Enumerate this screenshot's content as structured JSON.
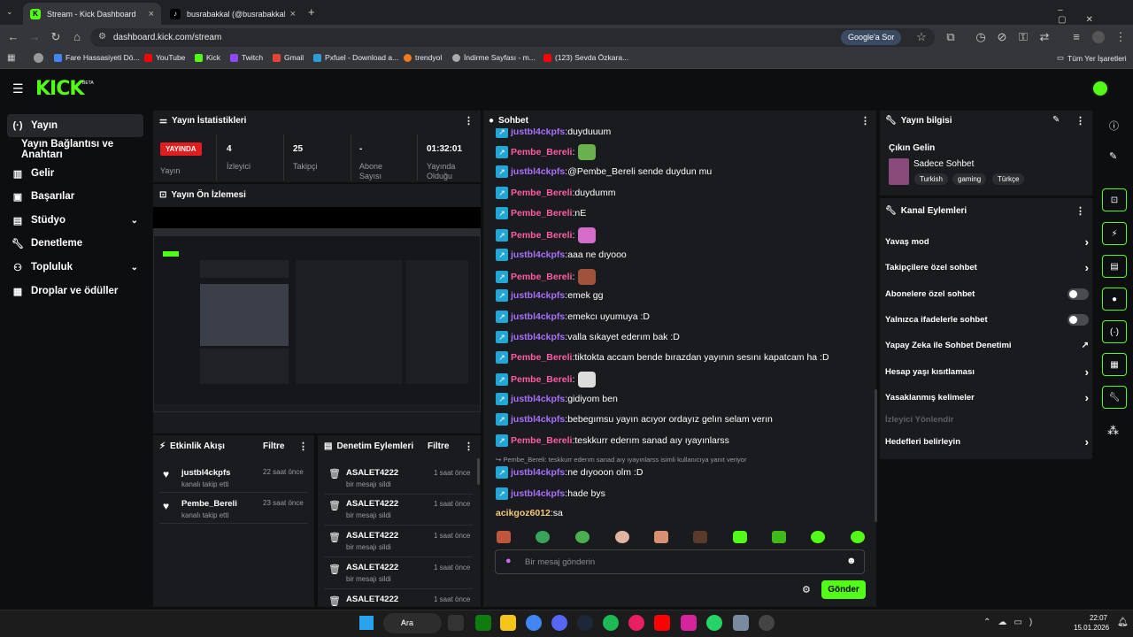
{
  "browser": {
    "tabs": [
      {
        "title": "Stream - Kick Dashboard",
        "favicon": "kick-logo-icon"
      },
      {
        "title": "busrabakkal (@busrabakkal",
        "favicon": "tiktok-icon"
      }
    ],
    "url": "dashboard.kick.com/stream",
    "google_btn": "Google'a Sor",
    "bookmarks": [
      "Fare Hassasiyeti Dö...",
      "YouTube",
      "Kick",
      "Twitch",
      "Gmail",
      "Pxfuel - Download a...",
      "trendyol",
      "İndirme Sayfası - m...",
      "(123) Sevda Özkara...",
      "Tüm Yer İşaretleri"
    ]
  },
  "nav": {
    "items": [
      {
        "label": "Yayın",
        "icon": "broadcast-icon"
      },
      {
        "label": "Yayın Bağlantısı ve Anahtarı",
        "icon": ""
      },
      {
        "label": "Gelir",
        "icon": "chart-icon"
      },
      {
        "label": "Başarılar",
        "icon": "trophy-icon"
      },
      {
        "label": "Stüdyo",
        "icon": "studio-icon"
      },
      {
        "label": "Denetleme",
        "icon": "wrench-icon"
      },
      {
        "label": "Topluluk",
        "icon": "people-icon"
      },
      {
        "label": "Droplar ve ödüller",
        "icon": "gift-icon"
      }
    ]
  },
  "stats": {
    "title": "Yayın İstatistikleri",
    "live": "YAYINDA",
    "status_label": "Yayın",
    "viewers": "4",
    "viewers_label": "İzleyici",
    "followers": "25",
    "followers_label": "Takipçi",
    "subs": "-",
    "subs_label": "Abone Sayısı",
    "duration": "01:32:01",
    "duration_label": "Yayında Olduğu"
  },
  "preview": {
    "title": "Yayın Ön İzlemesi"
  },
  "activity": {
    "title": "Etkinlik Akışı",
    "filter": "Filtre",
    "items": [
      {
        "name": "justbl4ckpfs",
        "sub": "kanalı takip etti",
        "time": "22 saat önce"
      },
      {
        "name": "Pembe_Bereli",
        "sub": "kanalı takip etti",
        "time": "23 saat önce"
      }
    ]
  },
  "mod": {
    "title": "Denetim Eylemleri",
    "filter": "Filtre",
    "items": [
      {
        "name": "ASALET4222",
        "sub": "bir mesajı sildi",
        "time": "1 saat önce"
      },
      {
        "name": "ASALET4222",
        "sub": "bir mesajı sildi",
        "time": "1 saat önce"
      },
      {
        "name": "ASALET4222",
        "sub": "bir mesajı sildi",
        "time": "1 saat önce"
      },
      {
        "name": "ASALET4222",
        "sub": "bir mesajı sildi",
        "time": "1 saat önce"
      },
      {
        "name": "ASALET4222",
        "sub": "",
        "time": "1 saat önce"
      }
    ]
  },
  "chat": {
    "title": "Sohbet",
    "messages": [
      {
        "user": "justbl4ckpfs",
        "text": "duyduuum",
        "emote": ""
      },
      {
        "user": "Pembe_Bereli",
        "text": "",
        "emote": "#6ab04c"
      },
      {
        "user": "justbl4ckpfs",
        "text": "@Pembe_Bereli sende duydun mu",
        "emote": ""
      },
      {
        "user": "Pembe_Bereli",
        "text": "duydumm",
        "emote": ""
      },
      {
        "user": "Pembe_Bereli",
        "text": "nE",
        "emote": ""
      },
      {
        "user": "Pembe_Bereli",
        "text": "",
        "emote": "#d66cc9"
      },
      {
        "user": "justbl4ckpfs",
        "text": "aaa ne dıyooo",
        "emote": ""
      },
      {
        "user": "Pembe_Bereli",
        "text": "",
        "emote": "#a0523d"
      },
      {
        "user": "justbl4ckpfs",
        "text": "emek gg",
        "emote": ""
      },
      {
        "user": "justbl4ckpfs",
        "text": "emekcı uyumuya :D",
        "emote": ""
      },
      {
        "user": "justbl4ckpfs",
        "text": "valla sıkayet ederım bak :D",
        "emote": ""
      },
      {
        "user": "Pembe_Bereli",
        "text": "tiktokta accam bende bırazdan yayının sesını kapatcam ha :D",
        "emote": ""
      },
      {
        "user": "Pembe_Bereli",
        "text": "",
        "emote": "#dddddd"
      },
      {
        "user": "justbl4ckpfs",
        "text": "gidiyom ben",
        "emote": ""
      },
      {
        "user": "justbl4ckpfs",
        "text": "bebegımsu yayın acıyor ordayız gelın selam verın",
        "emote": ""
      },
      {
        "user": "Pembe_Bereli",
        "text": "teskkurr ederım sanad aıy ıyayınlarss",
        "emote": ""
      }
    ],
    "reply_note": "Pembe_Bereli: teskkurr ederım sanad aıy ıyayınlarss isimli kullanıcıya yanıt veriyor",
    "after": [
      {
        "user": "justbl4ckpfs",
        "text": "ne dıyooon olm :D"
      },
      {
        "user": "justbl4ckpfs",
        "text": "hade bys"
      }
    ],
    "self": {
      "user": "acikgoz6012",
      "text": "sa"
    },
    "placeholder": "Bir mesaj gönderin",
    "send": "Gönder",
    "colors": {
      "justbl4ckpfs": "#a970ff",
      "Pembe_Bereli": "#ff5ca8",
      "acikgoz6012": "#f5c97a"
    }
  },
  "info": {
    "title": "Yayın bilgisi",
    "stream_title": "Çıkın Gelin",
    "category": "Sadece Sohbet",
    "tags": [
      "Turkish",
      "gaming",
      "Türkçe"
    ]
  },
  "channel": {
    "title": "Kanal Eylemleri",
    "rows": [
      {
        "label": "Yavaş mod",
        "type": "chevron"
      },
      {
        "label": "Takipçilere özel sohbet",
        "type": "chevron"
      },
      {
        "label": "Abonelere özel sohbet",
        "type": "toggle"
      },
      {
        "label": "Yalnızca ifadelerle sohbet",
        "type": "toggle"
      },
      {
        "label": "Yapay Zeka ile Sohbet Denetimi",
        "type": "external"
      },
      {
        "label": "Hesap yaşı kısıtlaması",
        "type": "chevron"
      },
      {
        "label": "Yasaklanmış kelimeler",
        "type": "chevron"
      },
      {
        "label": "İzleyici Yönlendir",
        "type": "disabled"
      },
      {
        "label": "Hedefleri belirleyin",
        "type": "chevron"
      }
    ]
  },
  "taskbar": {
    "search": "Ara",
    "time": "22:07",
    "date": "15.01.2026"
  },
  "accent": "#53fc18"
}
